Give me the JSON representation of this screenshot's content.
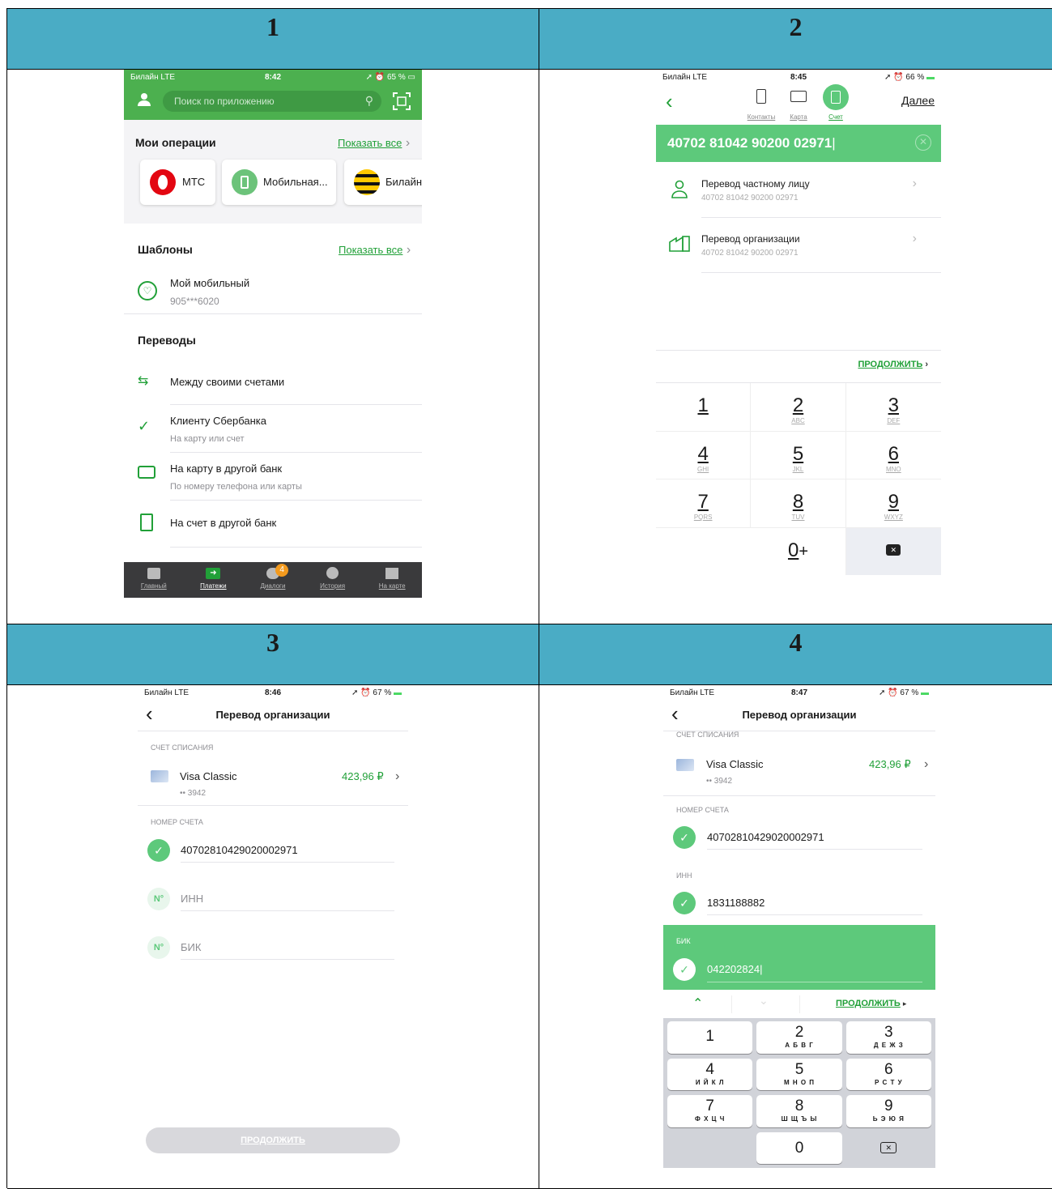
{
  "panels": {
    "p1": {
      "number": "1",
      "status": {
        "carrier": "Билайн  LTE",
        "time": "8:42",
        "battery": "65 %"
      },
      "search_placeholder": "Поиск по приложению",
      "ops": {
        "title": "Мои операции",
        "show_all": "Показать все",
        "items": [
          "МТС",
          "Мобильная...",
          "Билайн"
        ]
      },
      "templates": {
        "title": "Шаблоны",
        "show_all": "Показать все",
        "name": "Мой мобильный",
        "sub": "905***6020"
      },
      "transfers": {
        "title": "Переводы",
        "items": [
          {
            "label": "Между своими счетами",
            "sub": ""
          },
          {
            "label": "Клиенту Сбербанка",
            "sub": "На карту или счет"
          },
          {
            "label": "На карту в другой банк",
            "sub": "По номеру телефона или карты"
          },
          {
            "label": "На счет в другой банк",
            "sub": ""
          }
        ]
      },
      "tabbar": {
        "items": [
          "Главный",
          "Платежи",
          "Диалоги",
          "История",
          "На карте"
        ],
        "badge": "4"
      }
    },
    "p2": {
      "number": "2",
      "status": {
        "carrier": "Билайн  LTE",
        "time": "8:45",
        "battery": "66 %"
      },
      "next": "Далее",
      "tabs": [
        "Контакты",
        "Карта",
        "Счет"
      ],
      "account_input": "40702 81042 90200 02971",
      "options": [
        {
          "label": "Перевод частному лицу",
          "sub": "40702 81042 90200 02971"
        },
        {
          "label": "Перевод организации",
          "sub": "40702 81042 90200 02971"
        }
      ],
      "continue": "ПРОДОЛЖИТЬ",
      "keys": [
        {
          "d": "1",
          "l": ""
        },
        {
          "d": "2",
          "l": "ABC"
        },
        {
          "d": "3",
          "l": "DEF"
        },
        {
          "d": "4",
          "l": "GHI"
        },
        {
          "d": "5",
          "l": "JKL"
        },
        {
          "d": "6",
          "l": "MNO"
        },
        {
          "d": "7",
          "l": "PQRS"
        },
        {
          "d": "8",
          "l": "TUV"
        },
        {
          "d": "9",
          "l": "WXYZ"
        }
      ],
      "zero": "0",
      "plus": "+"
    },
    "p3": {
      "number": "3",
      "status": {
        "carrier": "Билайн  LTE",
        "time": "8:46",
        "battery": "67 %"
      },
      "title": "Перевод организации",
      "debit_label": "СЧЕТ СПИСАНИЯ",
      "card_name": "Visa Classic",
      "card_mask": "•• 3942",
      "card_balance": "423,96 ₽",
      "account_label": "НОМЕР СЧЕТА",
      "account": "40702810429020002971",
      "no_sign": "N°",
      "inn_ph": "ИНН",
      "bik_ph": "БИК",
      "continue": "ПРОДОЛЖИТЬ"
    },
    "p4": {
      "number": "4",
      "status": {
        "carrier": "Билайн  LTE",
        "time": "8:47",
        "battery": "67 %"
      },
      "title": "Перевод организации",
      "debit_label": "СЧЕТ СПИСАНИЯ",
      "card_name": "Visa Classic",
      "card_mask": "•• 3942",
      "card_balance": "423,96 ₽",
      "account_label": "НОМЕР СЧЕТА",
      "account": "40702810429020002971",
      "inn_label": "ИНН",
      "inn": "1831188882",
      "bik_label": "БИК",
      "bik": "042202824",
      "continue": "ПРОДОЛЖИТЬ",
      "keys": [
        {
          "d": "1",
          "l": ""
        },
        {
          "d": "2",
          "l": "А Б В Г"
        },
        {
          "d": "3",
          "l": "Д Е Ж З"
        },
        {
          "d": "4",
          "l": "И Й К Л"
        },
        {
          "d": "5",
          "l": "М Н О П"
        },
        {
          "d": "6",
          "l": "Р С Т У"
        },
        {
          "d": "7",
          "l": "Ф Х Ц Ч"
        },
        {
          "d": "8",
          "l": "Ш Щ Ъ Ы"
        },
        {
          "d": "9",
          "l": "Ь Э Ю Я"
        }
      ],
      "zero": "0"
    }
  },
  "colors": {
    "sber_green": "#21a038",
    "header_green": "#4cb04f",
    "bright_green": "#5dc97b",
    "table_header": "#4aacc5"
  }
}
